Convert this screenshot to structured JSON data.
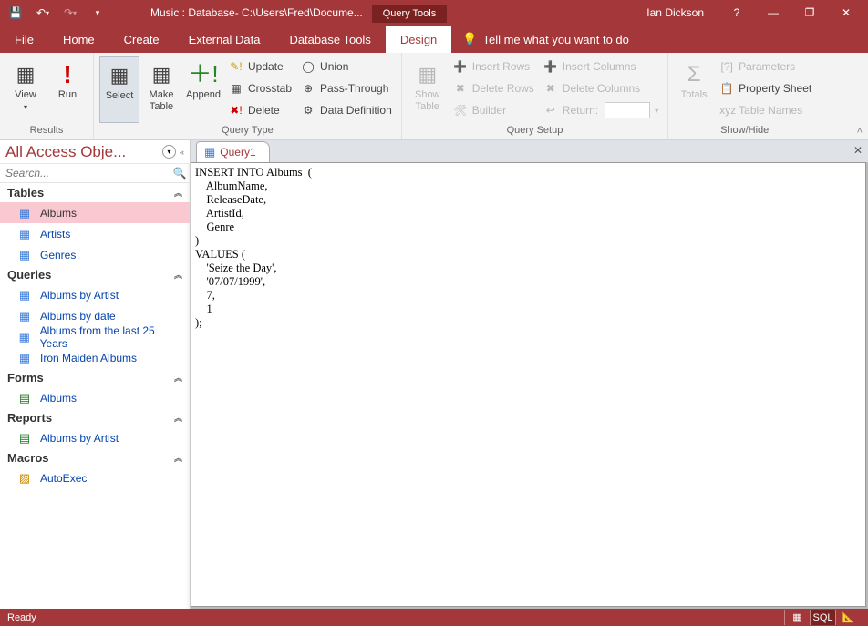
{
  "title": "Music : Database- C:\\Users\\Fred\\Docume...",
  "context_tab": "Query Tools",
  "user": "Ian Dickson",
  "tabs": {
    "file": "File",
    "home": "Home",
    "create": "Create",
    "external": "External Data",
    "dbtools": "Database Tools",
    "design": "Design"
  },
  "tellme": "Tell me what you want to do",
  "ribbon": {
    "view": "View",
    "run": "Run",
    "select": "Select",
    "maketable": "Make\nTable",
    "append": "Append",
    "update": "Update",
    "crosstab": "Crosstab",
    "delete": "Delete",
    "union": "Union",
    "passthrough": "Pass-Through",
    "datadef": "Data Definition",
    "showtable": "Show\nTable",
    "insertrows": "Insert Rows",
    "deleterows": "Delete Rows",
    "builder": "Builder",
    "insertcols": "Insert Columns",
    "deletecols": "Delete Columns",
    "return": "Return:",
    "totals": "Totals",
    "parameters": "Parameters",
    "propsheet": "Property Sheet",
    "tablenames": "Table Names",
    "g_results": "Results",
    "g_querytype": "Query Type",
    "g_querysetup": "Query Setup",
    "g_showhide": "Show/Hide"
  },
  "nav": {
    "title": "All Access Obje...",
    "search_placeholder": "Search...",
    "groups": {
      "tables": "Tables",
      "queries": "Queries",
      "forms": "Forms",
      "reports": "Reports",
      "macros": "Macros"
    },
    "tables": [
      "Albums",
      "Artists",
      "Genres"
    ],
    "queries": [
      "Albums by Artist",
      "Albums by date",
      "Albums from the last 25 Years",
      "Iron Maiden Albums"
    ],
    "forms": [
      "Albums"
    ],
    "reports": [
      "Albums by Artist"
    ],
    "macros": [
      "AutoExec"
    ]
  },
  "doc": {
    "tab": "Query1",
    "sql": "INSERT INTO Albums  (\n    AlbumName,\n    ReleaseDate,\n    ArtistId,\n    Genre\n)\nVALUES (\n    'Seize the Day',\n    '07/07/1999',\n    7,\n    1\n);"
  },
  "status": "Ready",
  "sqlview": "SQL"
}
